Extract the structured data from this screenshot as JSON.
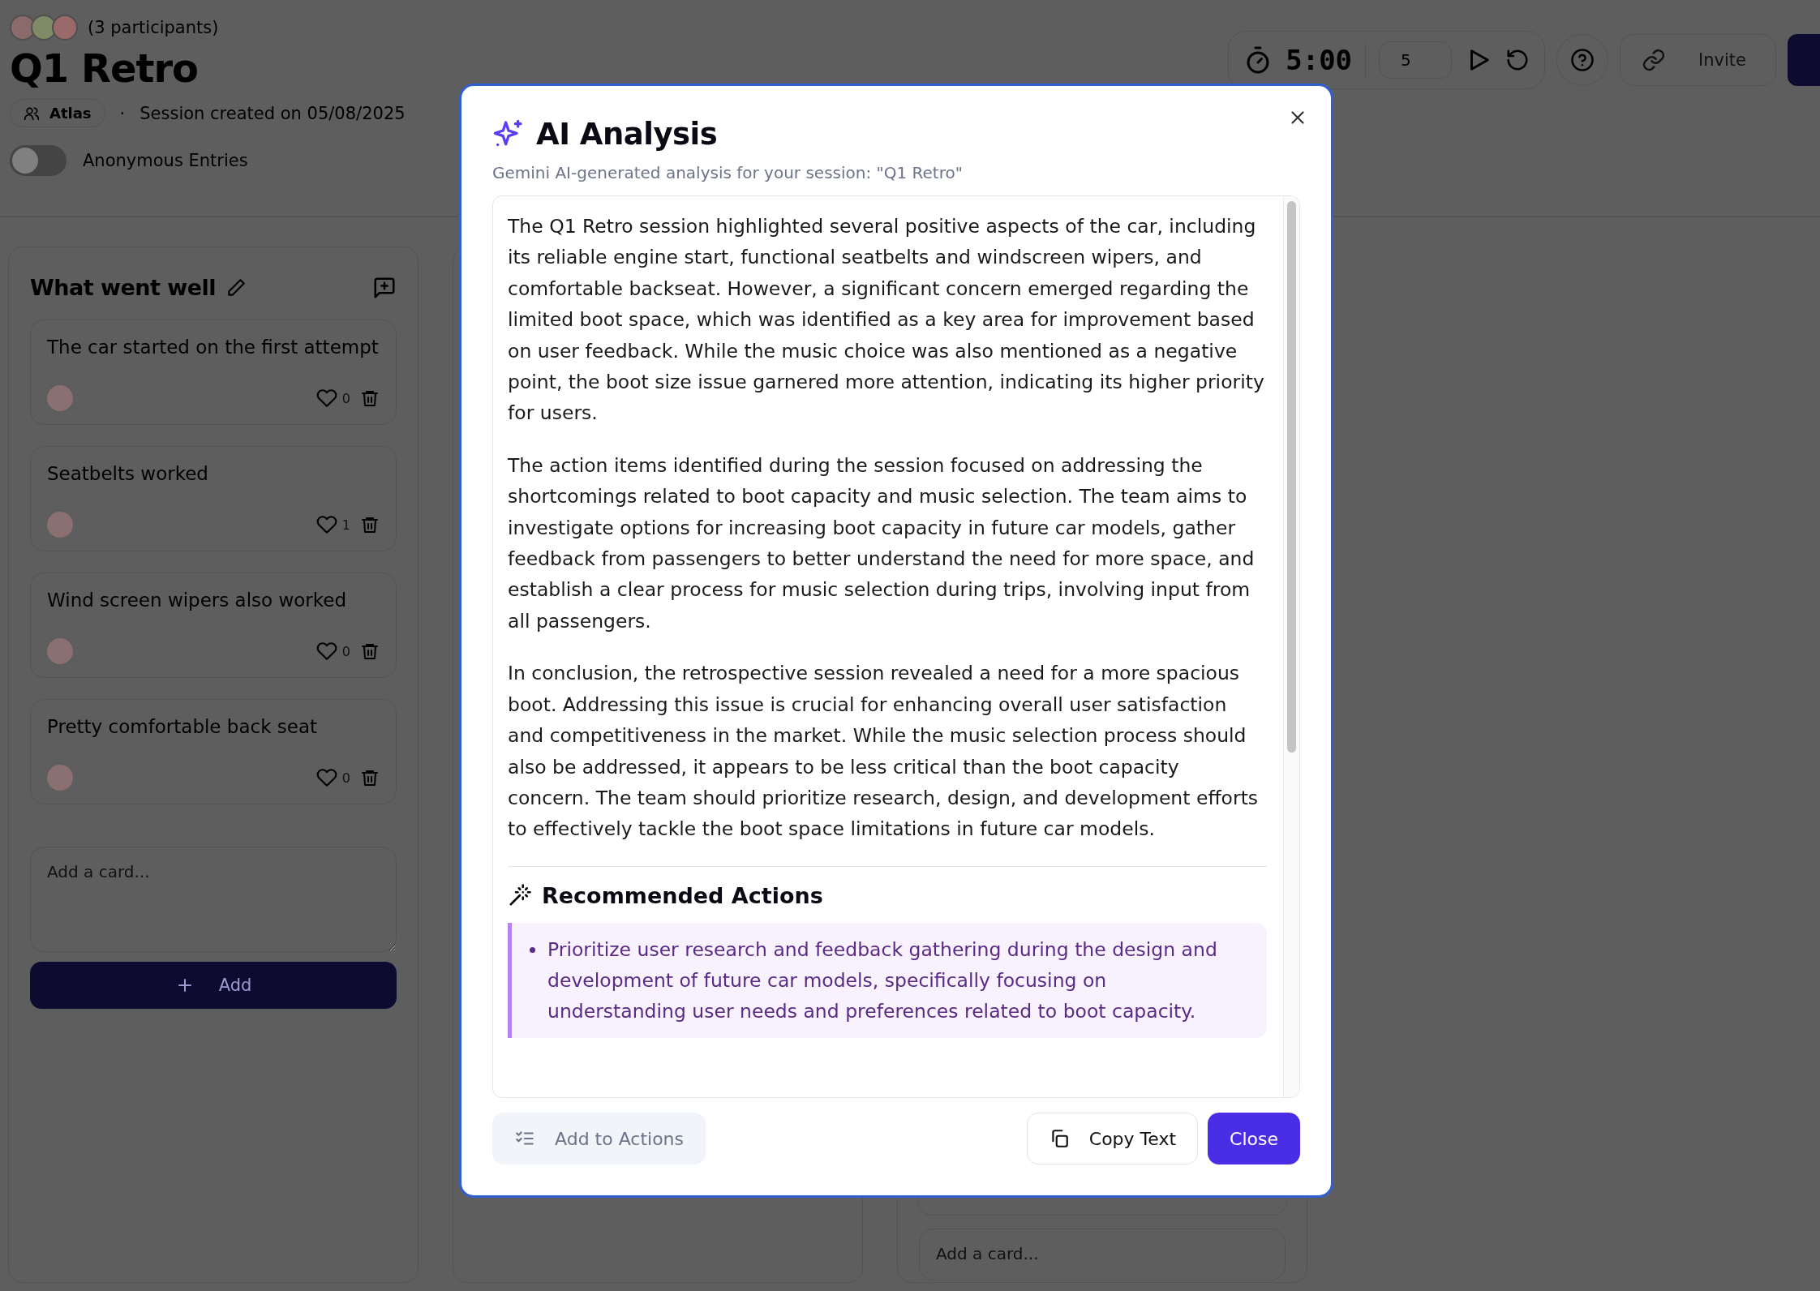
{
  "header": {
    "participants": {
      "avatars": [
        {
          "color": "#8a6a6a"
        },
        {
          "color": "#7f8a66"
        },
        {
          "color": "#9a6a6a"
        }
      ],
      "count": "(3 participants)"
    },
    "title": "Q1 Retro",
    "team": "Atlas",
    "separator": "·",
    "created": "Session created on 05/08/2025",
    "anonymous_toggle": {
      "label": "Anonymous Entries",
      "on": false
    }
  },
  "toolbar": {
    "timer": "5:00",
    "minutes": "5",
    "invite": "Invite"
  },
  "columns": [
    {
      "title": "What went well",
      "cards": [
        {
          "text": "The car started on the first attempt",
          "likes": "0"
        },
        {
          "text": "Seatbelts worked",
          "likes": "1"
        },
        {
          "text": "Wind screen wipers also worked",
          "likes": "0"
        },
        {
          "text": "Pretty comfortable back seat",
          "likes": "0"
        }
      ],
      "add_placeholder": "Add a card...",
      "add_button": "Add"
    },
    {},
    {
      "add_placeholder": "Add a card..."
    }
  ],
  "modal": {
    "title": "AI Analysis",
    "subtitle": "Gemini AI-generated analysis for your session: \"Q1 Retro\"",
    "paragraphs": [
      "The Q1 Retro session highlighted several positive aspects of the car, including its reliable engine start, functional seatbelts and windscreen wipers, and comfortable backseat. However, a significant concern emerged regarding the limited boot space, which was identified as a key area for improvement based on user feedback. While the music choice was also mentioned as a negative point, the boot size issue garnered more attention, indicating its higher priority for users.",
      "The action items identified during the session focused on addressing the shortcomings related to boot capacity and music selection. The team aims to investigate options for increasing boot capacity in future car models, gather feedback from passengers to better understand the need for more space, and establish a clear process for music selection during trips, involving input from all passengers.",
      "In conclusion, the retrospective session revealed a need for a more spacious boot. Addressing this issue is crucial for enhancing overall user satisfaction and competitiveness in the market. While the music selection process should also be addressed, it appears to be less critical than the boot capacity concern. The team should prioritize research, design, and development efforts to effectively tackle the boot space limitations in future car models."
    ],
    "actions_heading": "Recommended Actions",
    "actions": [
      "Prioritize user research and feedback gathering during the design and development of future car models, specifically focusing on understanding user needs and preferences related to boot capacity."
    ],
    "buttons": [
      {
        "label": "Add to Actions",
        "kind": "secondary"
      },
      {
        "label": "Copy Text",
        "kind": "outline"
      },
      {
        "label": "Close",
        "kind": "primary"
      }
    ]
  }
}
